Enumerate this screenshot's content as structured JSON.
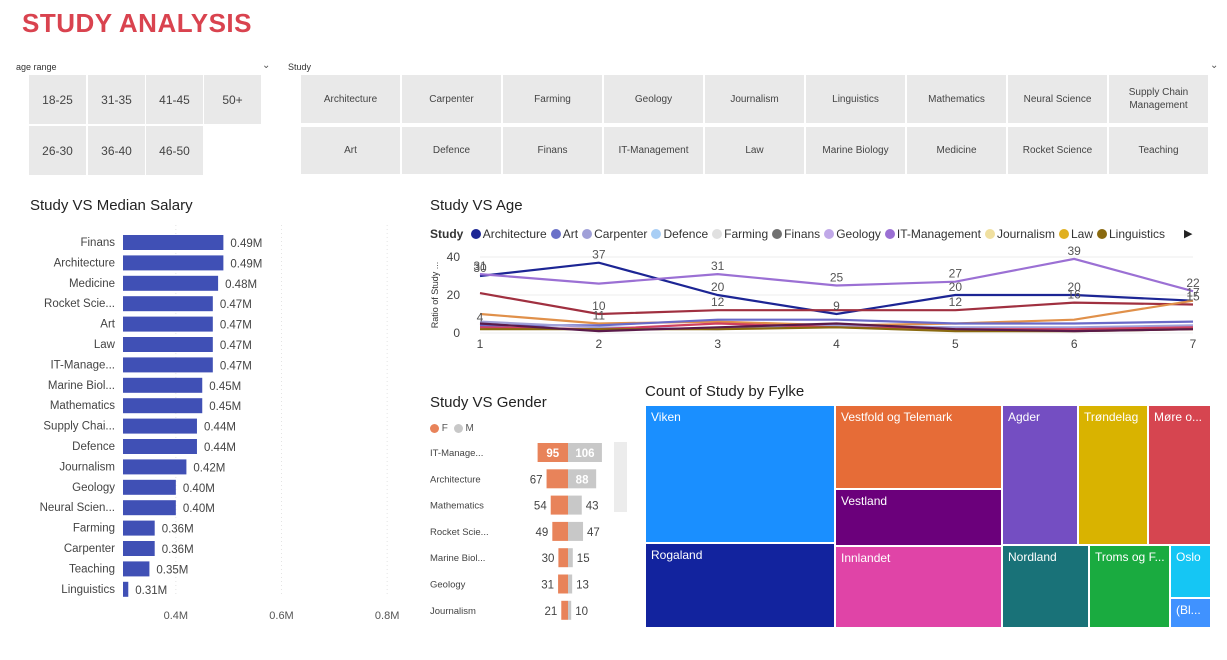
{
  "report_title": "STUDY ANALYSIS",
  "age_slicer": {
    "label": "age range",
    "options": [
      "18-25",
      "31-35",
      "41-45",
      "50+",
      "26-30",
      "36-40",
      "46-50"
    ]
  },
  "study_slicer": {
    "label": "Study",
    "options": [
      "Architecture",
      "Carpenter",
      "Farming",
      "Geology",
      "Journalism",
      "Linguistics",
      "Mathematics",
      "Neural Science",
      "Supply Chain Management",
      "Art",
      "Defence",
      "Finans",
      "IT-Management",
      "Law",
      "Marine Biology",
      "Medicine",
      "Rocket Science",
      "Teaching"
    ]
  },
  "colors": {
    "title": "#d9434f",
    "bar": "#4050b5",
    "female": "#e8835a",
    "male": "#c8c8c8"
  },
  "salary_chart": {
    "title": "Study VS Median Salary",
    "x_ticks": [
      "0.4M",
      "0.6M",
      "0.8M"
    ]
  },
  "age_chart": {
    "title": "Study VS Age",
    "legend_title": "Study",
    "y_axis_label": "Ratio of Study ...",
    "y_ticks": [
      "0",
      "20",
      "40"
    ],
    "x_ticks": [
      "1",
      "2",
      "3",
      "4",
      "5",
      "6",
      "7"
    ]
  },
  "gender_chart": {
    "title": "Study VS Gender",
    "legend": [
      "F",
      "M"
    ]
  },
  "treemap": {
    "title": "Count of Study by Fylke"
  },
  "chart_data": [
    {
      "type": "bar",
      "title": "Study VS Median Salary",
      "orientation": "horizontal",
      "categories": [
        "Finans",
        "Architecture",
        "Medicine",
        "Rocket Scie...",
        "Art",
        "Law",
        "IT-Manage...",
        "Marine Biol...",
        "Mathematics",
        "Supply Chai...",
        "Defence",
        "Journalism",
        "Geology",
        "Neural Scien...",
        "Farming",
        "Carpenter",
        "Teaching",
        "Linguistics"
      ],
      "values": [
        0.49,
        0.49,
        0.48,
        0.47,
        0.47,
        0.47,
        0.47,
        0.45,
        0.45,
        0.44,
        0.44,
        0.42,
        0.4,
        0.4,
        0.36,
        0.36,
        0.35,
        0.31
      ],
      "labels": [
        "0.49M",
        "0.49M",
        "0.48M",
        "0.47M",
        "0.47M",
        "0.47M",
        "0.47M",
        "0.45M",
        "0.45M",
        "0.44M",
        "0.44M",
        "0.42M",
        "0.40M",
        "0.40M",
        "0.36M",
        "0.36M",
        "0.35M",
        "0.31M"
      ],
      "xlim": [
        0.3,
        0.9
      ]
    },
    {
      "type": "line",
      "title": "Study VS Age",
      "x": [
        1,
        2,
        3,
        4,
        5,
        6,
        7
      ],
      "ylim": [
        0,
        40
      ],
      "legend": [
        "Architecture",
        "Art",
        "Carpenter",
        "Defence",
        "Farming",
        "Finans",
        "Geology",
        "IT-Management",
        "Journalism",
        "Law",
        "Linguistics"
      ],
      "series": [
        {
          "name": "Architecture",
          "color": "#1c2594",
          "values": [
            30,
            37,
            20,
            10,
            20,
            20,
            17
          ]
        },
        {
          "name": "IT-Management",
          "color": "#9b70d4",
          "values": [
            31,
            26,
            31,
            25,
            27,
            39,
            22
          ]
        },
        {
          "name": "Finans",
          "color": "#a03040",
          "values": [
            21,
            10,
            12,
            12,
            12,
            16,
            15
          ]
        },
        {
          "name": "Defence",
          "color": "#e0904a",
          "values": [
            10,
            5,
            6,
            4,
            5,
            7,
            17
          ]
        },
        {
          "name": "Geology",
          "color": "#6a6ac8",
          "values": [
            4,
            4,
            7,
            7,
            5,
            5,
            6
          ]
        },
        {
          "name": "Art",
          "color": "#a0a0d8",
          "values": [
            6,
            3,
            2,
            4,
            3,
            3,
            4
          ]
        },
        {
          "name": "Carpenter",
          "color": "#d04060",
          "values": [
            3,
            2,
            5,
            3,
            2,
            2,
            3
          ]
        },
        {
          "name": "Linguistics",
          "color": "#8a6a10",
          "values": [
            2,
            2,
            2,
            3,
            1,
            1,
            2
          ]
        },
        {
          "name": "Law",
          "color": "#5a1a4a",
          "values": [
            5,
            1,
            3,
            5,
            2,
            1,
            2
          ]
        }
      ],
      "point_labels": [
        {
          "x": 1,
          "y": 31,
          "text": "31"
        },
        {
          "x": 1,
          "y": 30,
          "text": "30"
        },
        {
          "x": 1,
          "y": 4,
          "text": "4"
        },
        {
          "x": 2,
          "y": 37,
          "text": "37"
        },
        {
          "x": 2,
          "y": 10,
          "text": "10"
        },
        {
          "x": 2,
          "y": 5,
          "text": "11"
        },
        {
          "x": 3,
          "y": 31,
          "text": "31"
        },
        {
          "x": 3,
          "y": 20,
          "text": "20"
        },
        {
          "x": 3,
          "y": 12,
          "text": "12"
        },
        {
          "x": 4,
          "y": 25,
          "text": "25"
        },
        {
          "x": 4,
          "y": 10,
          "text": "9"
        },
        {
          "x": 5,
          "y": 27,
          "text": "27"
        },
        {
          "x": 5,
          "y": 20,
          "text": "20"
        },
        {
          "x": 5,
          "y": 12,
          "text": "12"
        },
        {
          "x": 6,
          "y": 39,
          "text": "39"
        },
        {
          "x": 6,
          "y": 20,
          "text": "20"
        },
        {
          "x": 6,
          "y": 16,
          "text": "16"
        },
        {
          "x": 7,
          "y": 22,
          "text": "22"
        },
        {
          "x": 7,
          "y": 15,
          "text": "15"
        },
        {
          "x": 7,
          "y": 17,
          "text": "17"
        }
      ]
    },
    {
      "type": "bar",
      "title": "Study VS Gender",
      "orientation": "diverging",
      "categories": [
        "IT-Manage...",
        "Architecture",
        "Mathematics",
        "Rocket Scie...",
        "Marine Biol...",
        "Geology",
        "Journalism"
      ],
      "series": [
        {
          "name": "F",
          "values": [
            95,
            67,
            54,
            49,
            30,
            31,
            21
          ]
        },
        {
          "name": "M",
          "values": [
            106,
            88,
            43,
            47,
            15,
            13,
            10
          ]
        }
      ]
    },
    {
      "type": "treemap",
      "title": "Count of Study by Fylke",
      "categories": [
        "Viken",
        "Rogaland",
        "Vestfold og Telemark",
        "Vestland",
        "Innlandet",
        "Agder",
        "Nordland",
        "Trøndelag",
        "Troms og F...",
        "Møre o...",
        "Oslo",
        "(Bl..."
      ],
      "colors": [
        "#1a8fff",
        "#12239e",
        "#e66c37",
        "#6b007b",
        "#e044a7",
        "#744ec2",
        "#197278",
        "#d9b300",
        "#1aab40",
        "#d64550",
        "#15c6f4",
        "#4092ff"
      ]
    }
  ]
}
